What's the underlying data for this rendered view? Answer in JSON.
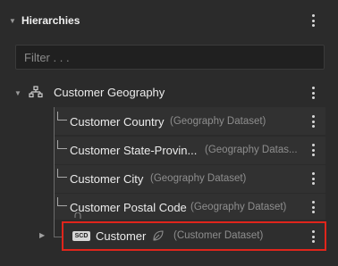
{
  "header": {
    "title": "Hierarchies"
  },
  "filter": {
    "placeholder": "Filter . . ."
  },
  "root": {
    "label": "Customer Geography"
  },
  "items": [
    {
      "label": "Customer Country",
      "dataset": "(Geography Dataset)"
    },
    {
      "label": "Customer State-Provin...",
      "dataset": "(Geography Datas..."
    },
    {
      "label": "Customer City",
      "dataset": "(Geography Dataset)"
    },
    {
      "label": "Customer Postal Code",
      "dataset": "(Geography Dataset)"
    }
  ],
  "selected": {
    "badge": "SCD",
    "label": "Customer",
    "dataset": "(Customer Dataset)"
  },
  "colors": {
    "highlight": "#e0251b",
    "background": "#2b2b2b"
  }
}
